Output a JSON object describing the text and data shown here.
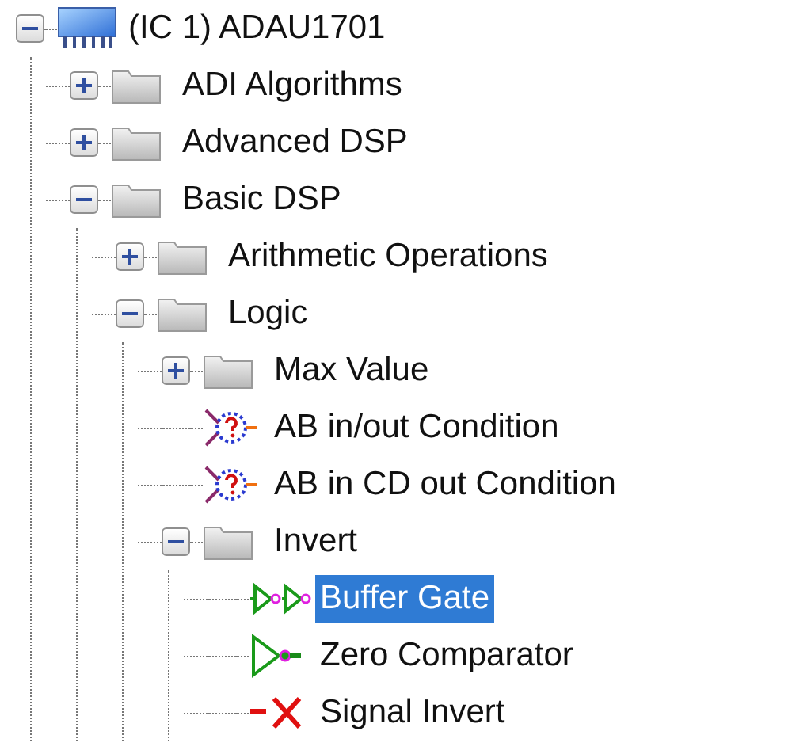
{
  "tree": [
    {
      "label": "(IC 1) ADAU1701",
      "kind": "chip",
      "expanded": true,
      "selected": false,
      "children": [
        {
          "label": "ADI Algorithms",
          "kind": "folder",
          "expanded": false,
          "selected": false
        },
        {
          "label": "Advanced DSP",
          "kind": "folder",
          "expanded": false,
          "selected": false
        },
        {
          "label": "Basic DSP",
          "kind": "folder",
          "expanded": true,
          "selected": false,
          "children": [
            {
              "label": "Arithmetic Operations",
              "kind": "folder",
              "expanded": false,
              "selected": false
            },
            {
              "label": "Logic",
              "kind": "folder",
              "expanded": true,
              "selected": false,
              "children": [
                {
                  "label": "Max Value",
                  "kind": "folder",
                  "expanded": false,
                  "selected": false
                },
                {
                  "label": "AB in/out Condition",
                  "kind": "condition",
                  "selected": false
                },
                {
                  "label": "AB in CD out Condition",
                  "kind": "condition",
                  "selected": false
                },
                {
                  "label": "Invert",
                  "kind": "folder",
                  "expanded": true,
                  "selected": false,
                  "children": [
                    {
                      "label": "Buffer Gate",
                      "kind": "buffer",
                      "selected": true
                    },
                    {
                      "label": "Zero Comparator",
                      "kind": "comparator",
                      "selected": false
                    },
                    {
                      "label": "Signal Invert",
                      "kind": "inverter",
                      "selected": false
                    }
                  ]
                }
              ]
            }
          ]
        }
      ]
    }
  ]
}
